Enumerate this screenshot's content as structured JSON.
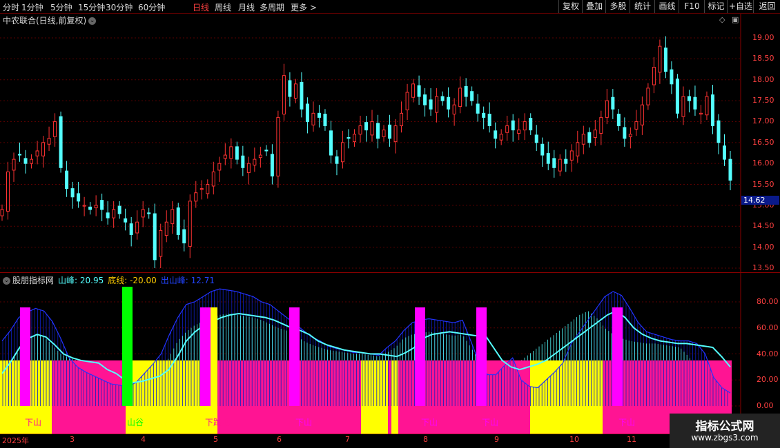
{
  "toolbar": {
    "periods": [
      {
        "label": "分时",
        "active": false
      },
      {
        "label": "1分钟",
        "active": false
      },
      {
        "label": "5分钟",
        "active": false
      },
      {
        "label": "15分钟",
        "active": false
      },
      {
        "label": "30分钟",
        "active": false
      },
      {
        "label": "60分钟",
        "active": false
      },
      {
        "label": "日线",
        "active": true
      },
      {
        "label": "周线",
        "active": false
      },
      {
        "label": "月线",
        "active": false
      },
      {
        "label": "多周期",
        "active": false
      },
      {
        "label": "更多 >",
        "active": false
      }
    ],
    "buttons": [
      "复权",
      "叠加",
      "多股",
      "统计",
      "画线",
      "F10",
      "标记",
      "+自选",
      "返回"
    ]
  },
  "main_chart": {
    "title": "中农联合(日线,前复权)",
    "current_price_tag": "14.62",
    "price_axis": [
      "19.00",
      "18.50",
      "18.00",
      "17.50",
      "17.00",
      "16.50",
      "16.00",
      "15.50",
      "15.00",
      "14.50",
      "14.00",
      "13.50"
    ],
    "colors": {
      "up": "#ff3232",
      "down": "#54ffff",
      "grid": "#5a0000"
    }
  },
  "indicator": {
    "name": "股朋指标网",
    "items": [
      {
        "label": "山峰: 20.95",
        "color": "#54ffff"
      },
      {
        "label": "底线: -20.00",
        "color": "#ffcc00"
      },
      {
        "label": "出山峰: 12.71",
        "color": "#2244ff"
      }
    ],
    "axis": [
      "80.00",
      "60.00",
      "40.00",
      "20.00",
      "0.00"
    ],
    "zone_labels": [
      {
        "text": "下山",
        "color": "#ff1493"
      },
      {
        "text": "山谷",
        "color": "#00ff00"
      },
      {
        "text": "下跑吧",
        "color": "#ff1493"
      },
      {
        "text": "下山",
        "color": "#ff00ff"
      },
      {
        "text": "下山",
        "color": "#ff00ff"
      },
      {
        "text": "下山",
        "color": "#ff00ff"
      },
      {
        "text": "下山",
        "color": "#ff00ff"
      }
    ],
    "colors": {
      "yellow": "#ffff00",
      "pink": "#ff1493",
      "magenta": "#ff00ff",
      "green": "#00ff00",
      "cyan": "#54ffff",
      "blue": "#2233ff"
    }
  },
  "date_axis": [
    "2025年",
    "3",
    "4",
    "5",
    "6",
    "7",
    "8",
    "9",
    "10",
    "11"
  ],
  "watermark": {
    "title": "指标公式网",
    "url": "www.zbgs3.com"
  },
  "chart_data": [
    {
      "type": "candlestick",
      "title": "中农联合(日线,前复权)",
      "ylim": [
        13.2,
        19.3
      ],
      "x_ticks": [
        "2025年",
        "3",
        "4",
        "5",
        "6",
        "7",
        "8",
        "9",
        "10",
        "11"
      ],
      "close_series": [
        14.9,
        15.8,
        16.1,
        16.2,
        16.0,
        16.1,
        16.3,
        16.5,
        16.6,
        17.0,
        15.9,
        15.4,
        15.2,
        15.1,
        15.0,
        14.9,
        15.0,
        14.9,
        14.7,
        14.9,
        14.8,
        14.6,
        14.3,
        14.6,
        14.9,
        14.8,
        13.7,
        14.4,
        14.6,
        14.9,
        14.3,
        14.1,
        15.1,
        15.3,
        15.4,
        15.5,
        15.8,
        16.0,
        16.2,
        16.4,
        16.1,
        15.9,
        16.0,
        16.1,
        16.2,
        16.3,
        15.7,
        17.1,
        18.1,
        17.6,
        17.9,
        17.3,
        17.0,
        17.2,
        17.1,
        16.9,
        16.2,
        16.0,
        16.5,
        16.6,
        16.7,
        16.9,
        16.8,
        17.0,
        16.6,
        16.8,
        16.6,
        16.9,
        17.2,
        17.7,
        17.9,
        17.6,
        17.4,
        17.3,
        17.6,
        17.5,
        17.3,
        17.4,
        17.8,
        17.6,
        17.5,
        17.2,
        17.1,
        16.9,
        16.6,
        16.7,
        16.9,
        16.8,
        16.8,
        17.0,
        16.8,
        16.5,
        16.2,
        16.0,
        15.9,
        16.1,
        16.0,
        16.3,
        16.5,
        16.7,
        16.5,
        16.8,
        17.1,
        17.5,
        17.3,
        16.9,
        16.6,
        16.7,
        17.0,
        17.4,
        17.8,
        18.3,
        18.8,
        18.2,
        17.9,
        17.2,
        17.6,
        17.5,
        17.3,
        17.2,
        17.6,
        16.9,
        16.5,
        16.1,
        15.6
      ],
      "last_price": 14.62
    },
    {
      "type": "bar",
      "title": "股朋指标网",
      "series": [
        {
          "name": "山峰",
          "values": [
            25,
            34,
            45,
            52,
            55,
            53,
            47,
            40,
            37,
            35,
            34,
            33,
            28,
            25,
            20,
            18,
            19,
            21,
            23,
            28,
            38,
            50,
            57,
            62,
            65,
            68,
            70,
            71,
            70,
            69,
            68,
            66,
            63,
            60,
            58,
            55,
            50,
            47,
            45,
            43,
            42,
            41,
            40,
            40,
            39,
            38,
            41,
            45,
            52,
            55,
            56,
            57,
            56,
            55,
            54,
            55,
            45,
            35,
            30,
            28,
            30,
            32,
            35,
            40,
            45,
            50,
            55,
            60,
            65,
            70,
            73,
            68,
            60,
            55,
            52,
            50,
            49,
            48,
            48,
            47,
            46,
            45,
            38,
            30
          ]
        },
        {
          "name": "出山峰",
          "values": [
            50,
            58,
            68,
            72,
            75,
            73,
            65,
            52,
            37,
            30,
            26,
            23,
            20,
            17,
            16,
            15,
            18,
            25,
            32,
            40,
            55,
            68,
            78,
            80,
            84,
            88,
            90,
            89,
            88,
            86,
            84,
            80,
            78,
            73,
            68,
            63,
            58,
            53,
            50,
            46,
            44,
            43,
            41,
            41,
            40,
            39,
            45,
            50,
            58,
            64,
            66,
            67,
            66,
            65,
            64,
            66,
            50,
            33,
            24,
            24,
            31,
            37,
            20,
            15,
            14,
            20,
            26,
            33,
            48,
            57,
            66,
            75,
            84,
            88,
            85,
            75,
            64,
            57,
            55,
            53,
            51,
            50,
            50,
            48,
            40,
            22,
            14,
            10
          ]
        }
      ],
      "ylim": [
        -5,
        100
      ],
      "baseline": 35,
      "markers": [
        {
          "color": "magenta",
          "at": "3"
        },
        {
          "color": "green",
          "at": "4"
        },
        {
          "color": "magenta",
          "at": "5"
        },
        {
          "color": "magenta",
          "at": "6"
        },
        {
          "color": "magenta",
          "at": "8"
        },
        {
          "color": "magenta",
          "at": "9"
        },
        {
          "color": "magenta",
          "at": "11"
        }
      ]
    }
  ]
}
